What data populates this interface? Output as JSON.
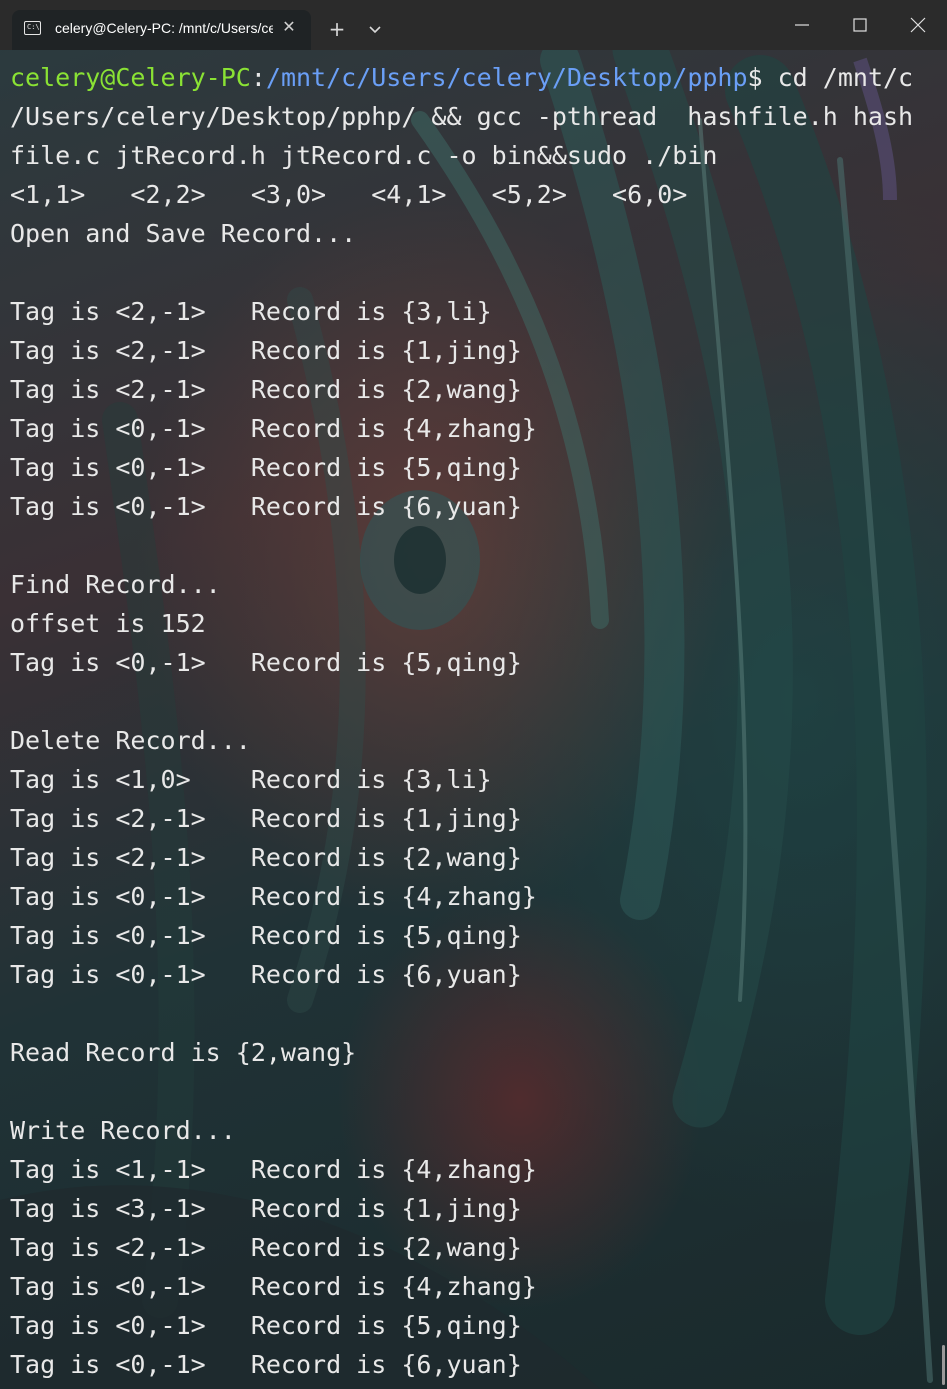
{
  "window": {
    "tab_title": "celery@Celery-PC: /mnt/c/Users/celery/Desktop/pphp",
    "tab_icon": "terminal-icon",
    "controls": [
      "minimize-icon",
      "maximize-icon",
      "close-icon"
    ]
  },
  "colors": {
    "user_host": "#8ae234",
    "path": "#6a9ff6",
    "text": "#e8e8e8"
  },
  "prompt": {
    "user_host": "celery@Celery-PC",
    "separator": ":",
    "path": "/mnt/c/Users/celery/Desktop/pphp",
    "command_start": "$ cd /mnt/c"
  },
  "lines": [
    "/Users/celery/Desktop/pphp/ && gcc -pthread  hashfile.h hash",
    "file.c jtRecord.h jtRecord.c -o bin&&sudo ./bin",
    "<1,1>   <2,2>   <3,0>   <4,1>   <5,2>   <6,0>",
    "Open and Save Record...",
    "",
    "Tag is <2,-1>   Record is {3,li}",
    "Tag is <2,-1>   Record is {1,jing}",
    "Tag is <2,-1>   Record is {2,wang}",
    "Tag is <0,-1>   Record is {4,zhang}",
    "Tag is <0,-1>   Record is {5,qing}",
    "Tag is <0,-1>   Record is {6,yuan}",
    "",
    "Find Record...",
    "offset is 152",
    "Tag is <0,-1>   Record is {5,qing}",
    "",
    "Delete Record...",
    "Tag is <1,0>    Record is {3,li}",
    "Tag is <2,-1>   Record is {1,jing}",
    "Tag is <2,-1>   Record is {2,wang}",
    "Tag is <0,-1>   Record is {4,zhang}",
    "Tag is <0,-1>   Record is {5,qing}",
    "Tag is <0,-1>   Record is {6,yuan}",
    "",
    "Read Record is {2,wang}",
    "",
    "Write Record...",
    "Tag is <1,-1>   Record is {4,zhang}",
    "Tag is <3,-1>   Record is {1,jing}",
    "Tag is <2,-1>   Record is {2,wang}",
    "Tag is <0,-1>   Record is {4,zhang}",
    "Tag is <0,-1>   Record is {5,qing}",
    "Tag is <0,-1>   Record is {6,yuan}"
  ]
}
